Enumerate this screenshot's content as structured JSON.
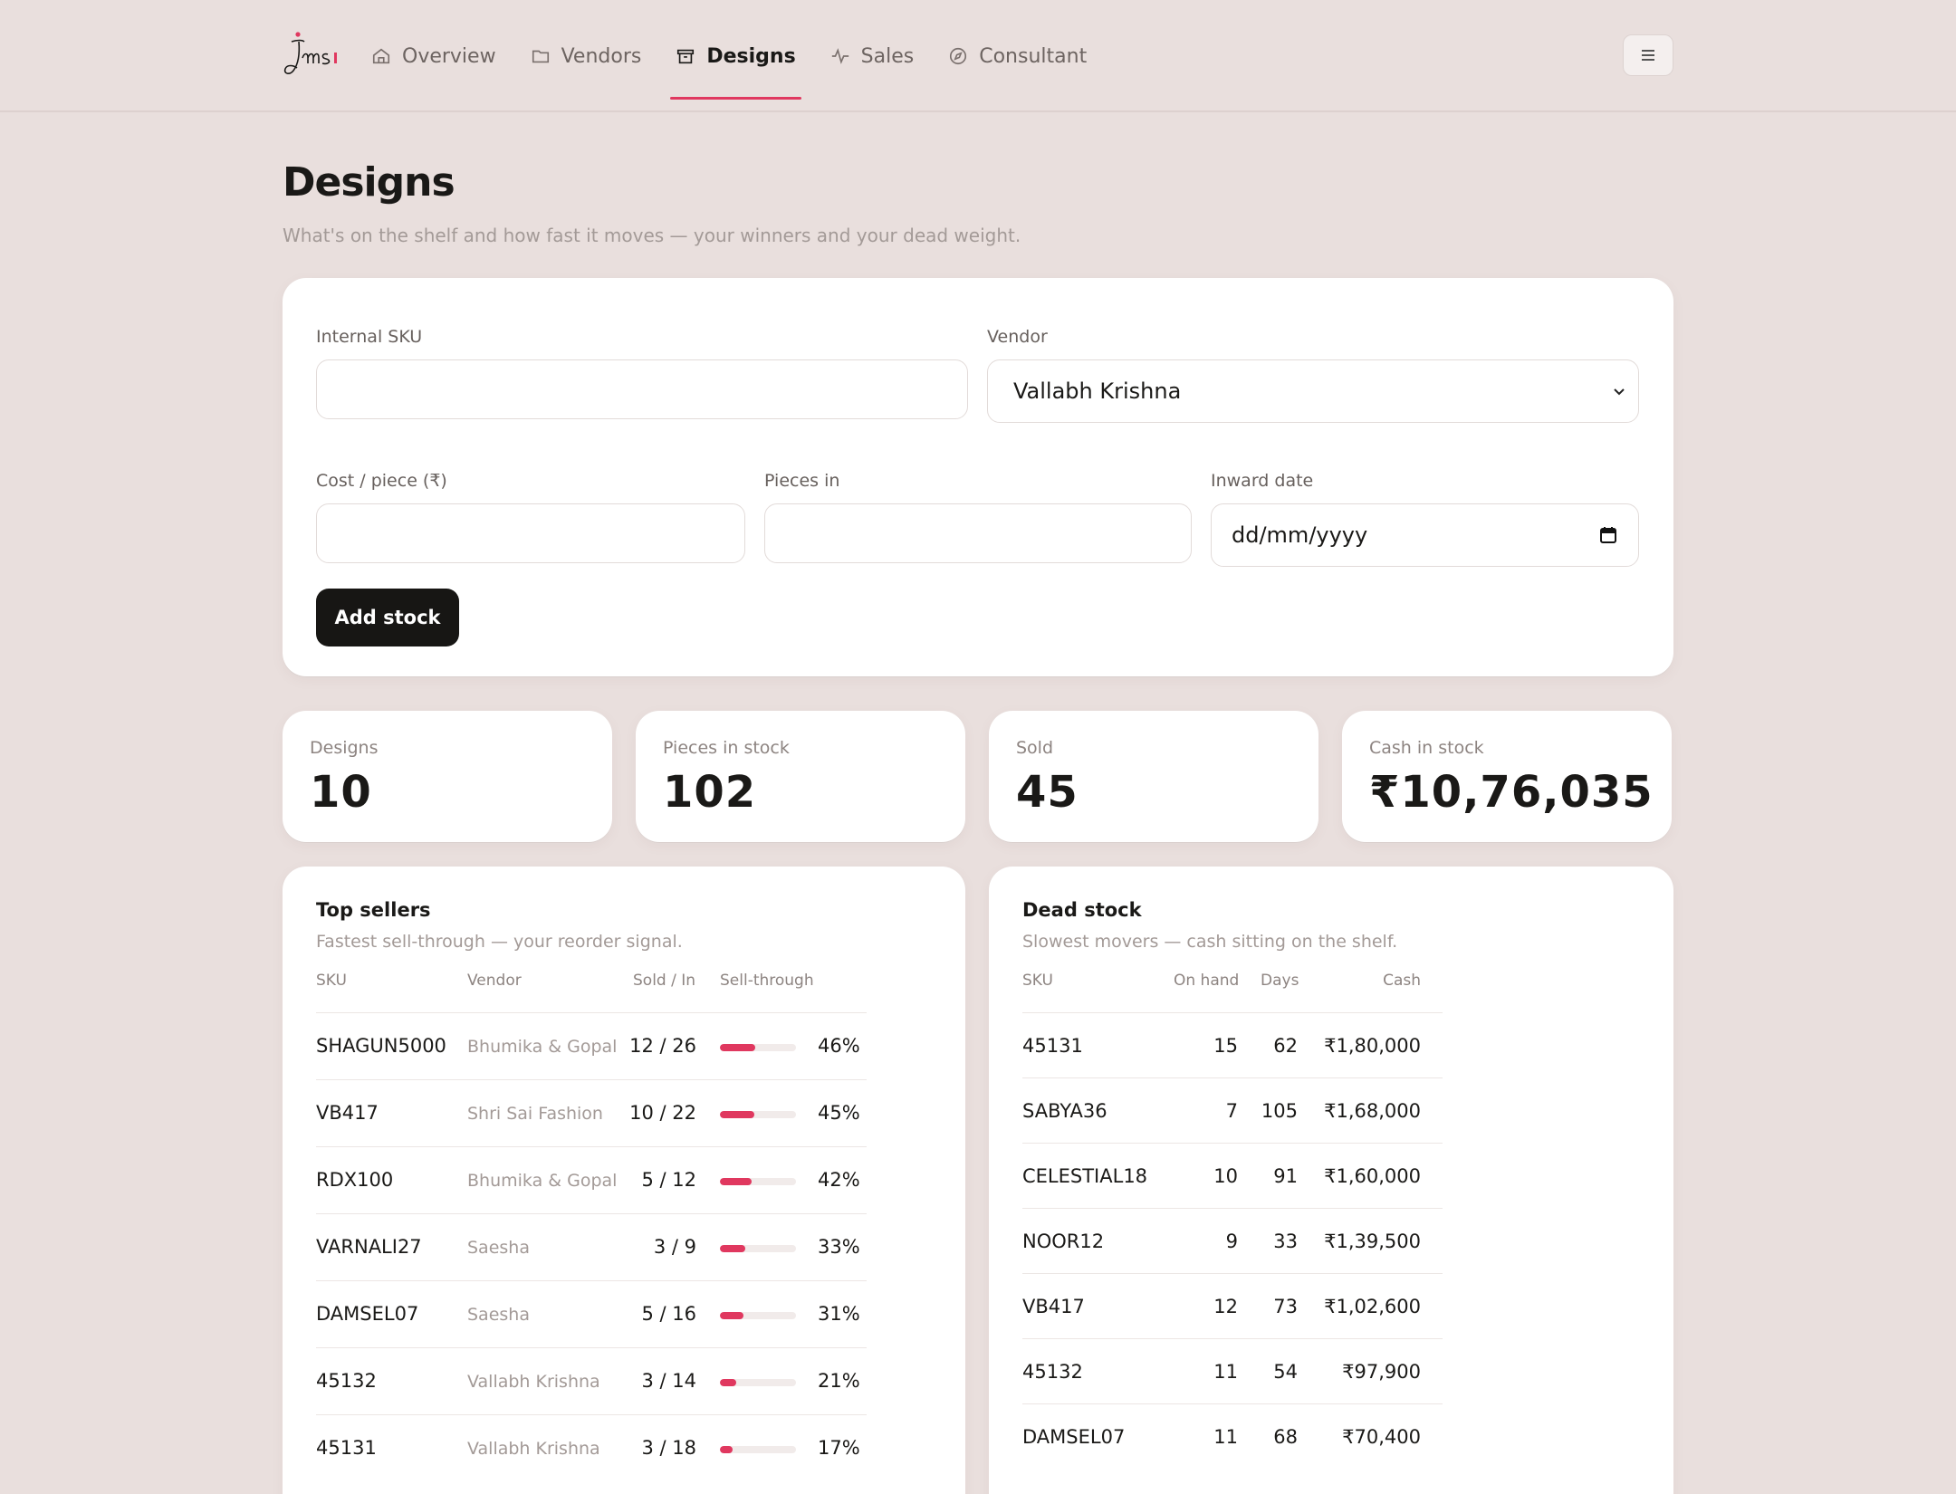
{
  "nav": {
    "logo_text": "jms",
    "items": [
      {
        "label": "Overview",
        "icon": "home-icon"
      },
      {
        "label": "Vendors",
        "icon": "folder-icon"
      },
      {
        "label": "Designs",
        "icon": "archive-icon",
        "active": true
      },
      {
        "label": "Sales",
        "icon": "activity-icon"
      },
      {
        "label": "Consultant",
        "icon": "compass-icon"
      }
    ],
    "menu_icon": "hamburger-menu-icon"
  },
  "header": {
    "title": "Designs",
    "subtitle": "What's on the shelf and how fast it moves — your winners and your dead weight."
  },
  "form": {
    "sku_label": "Internal SKU",
    "sku_value": "",
    "vendor_label": "Vendor",
    "vendor_value": "Vallabh Krishna",
    "cost_label": "Cost / piece (₹)",
    "cost_value": "",
    "pieces_label": "Pieces in",
    "pieces_value": "",
    "date_label": "Inward date",
    "date_placeholder": "dd/mm/yyyy",
    "submit_label": "Add stock"
  },
  "stats": [
    {
      "label": "Designs",
      "value": "10"
    },
    {
      "label": "Pieces in stock",
      "value": "102"
    },
    {
      "label": "Sold",
      "value": "45"
    },
    {
      "label": "Cash in stock",
      "value": "₹10,76,035"
    }
  ],
  "top_sellers": {
    "title": "Top sellers",
    "subtitle": "Fastest sell-through — your reorder signal.",
    "columns": [
      "SKU",
      "Vendor",
      "Sold / In",
      "Sell-through"
    ],
    "rows": [
      {
        "sku": "SHAGUN5000",
        "vendor": "Bhumika & Gopal",
        "sold_in": "12 / 26",
        "pct_label": "46%",
        "pct": 46
      },
      {
        "sku": "VB417",
        "vendor": "Shri Sai Fashion",
        "sold_in": "10 / 22",
        "pct_label": "45%",
        "pct": 45
      },
      {
        "sku": "RDX100",
        "vendor": "Bhumika & Gopal",
        "sold_in": "5 / 12",
        "pct_label": "42%",
        "pct": 42
      },
      {
        "sku": "VARNALI27",
        "vendor": "Saesha",
        "sold_in": "3 / 9",
        "pct_label": "33%",
        "pct": 33
      },
      {
        "sku": "DAMSEL07",
        "vendor": "Saesha",
        "sold_in": "5 / 16",
        "pct_label": "31%",
        "pct": 31
      },
      {
        "sku": "45132",
        "vendor": "Vallabh Krishna",
        "sold_in": "3 / 14",
        "pct_label": "21%",
        "pct": 21
      },
      {
        "sku": "45131",
        "vendor": "Vallabh Krishna",
        "sold_in": "3 / 18",
        "pct_label": "17%",
        "pct": 17
      }
    ]
  },
  "dead_stock": {
    "title": "Dead stock",
    "subtitle": "Slowest movers — cash sitting on the shelf.",
    "columns": [
      "SKU",
      "On hand",
      "Days",
      "Cash"
    ],
    "rows": [
      {
        "sku": "45131",
        "on_hand": "15",
        "days": "62",
        "cash": "₹1,80,000"
      },
      {
        "sku": "SABYA36",
        "on_hand": "7",
        "days": "105",
        "cash": "₹1,68,000"
      },
      {
        "sku": "CELESTIAL18",
        "on_hand": "10",
        "days": "91",
        "cash": "₹1,60,000"
      },
      {
        "sku": "NOOR12",
        "on_hand": "9",
        "days": "33",
        "cash": "₹1,39,500"
      },
      {
        "sku": "VB417",
        "on_hand": "12",
        "days": "73",
        "cash": "₹1,02,600"
      },
      {
        "sku": "45132",
        "on_hand": "11",
        "days": "54",
        "cash": "₹97,900"
      },
      {
        "sku": "DAMSEL07",
        "on_hand": "11",
        "days": "68",
        "cash": "₹70,400"
      }
    ]
  },
  "colors": {
    "background": "#e9dfdd",
    "accent": "#e0385f",
    "button": "#171614"
  }
}
